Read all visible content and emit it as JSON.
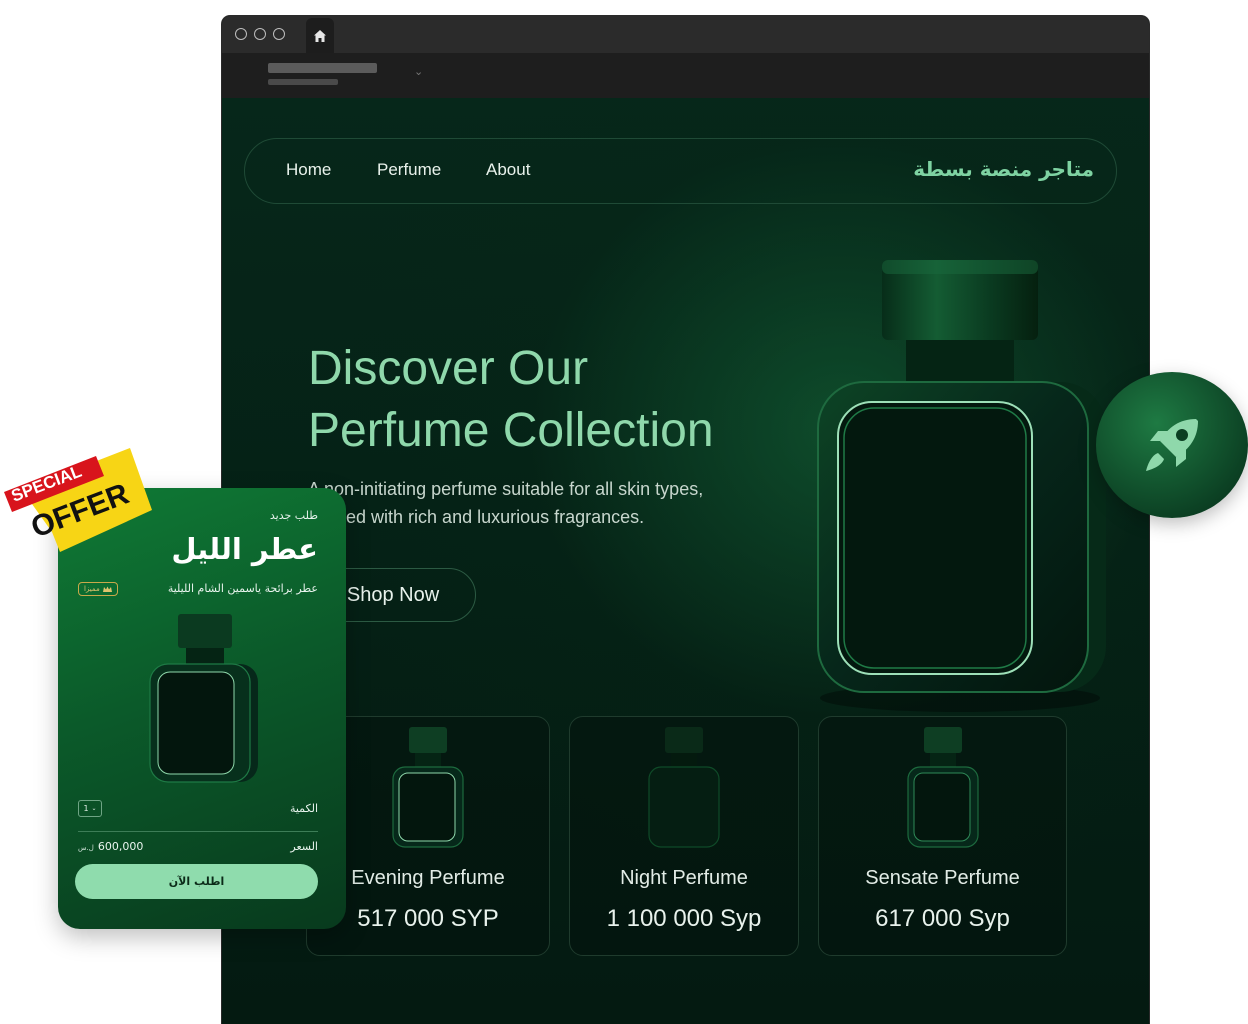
{
  "browser": {
    "home_icon": "home-icon",
    "dropdown_icon": "chevron-down-icon"
  },
  "nav": {
    "links": [
      "Home",
      "Perfume",
      "About"
    ],
    "brand": "متاجر منصة بسطة"
  },
  "hero": {
    "title_line1": "Discover Our",
    "title_line2": "Perfume Collection",
    "desc_line1": "A non-initiating perfume suitable for all skin types,",
    "desc_line2": "infused with rich and luxurious fragrances.",
    "cta": "Shop Now"
  },
  "products": [
    {
      "name": "Evening Perfume",
      "price": "517 000 SYP"
    },
    {
      "name": "Night Perfume",
      "price": "1 100 000 Syp"
    },
    {
      "name": "Sensate Perfume",
      "price": "617 000 Syp"
    }
  ],
  "rocket": {
    "icon": "rocket-icon"
  },
  "offer": {
    "sticker_line1": "SPECIAL",
    "sticker_line2": "OFFER",
    "new_order": "طلب جديد",
    "title": "عطر الليل",
    "subtitle": "عطر برائحة ياسمين الشام الليلية",
    "badge": "مميزا",
    "quantity_label": "الكمية",
    "quantity_value": "1",
    "price_label": "السعر",
    "price_value": "600,000",
    "currency": "ل.س",
    "order_button": "اطلب الآن"
  },
  "colors": {
    "accent": "#8fd8ab",
    "background": "#03140d",
    "card_green": "#0f7a35",
    "button_mint": "#8fdcad",
    "sticker_yellow": "#f7d515",
    "sticker_red": "#d8141c"
  }
}
